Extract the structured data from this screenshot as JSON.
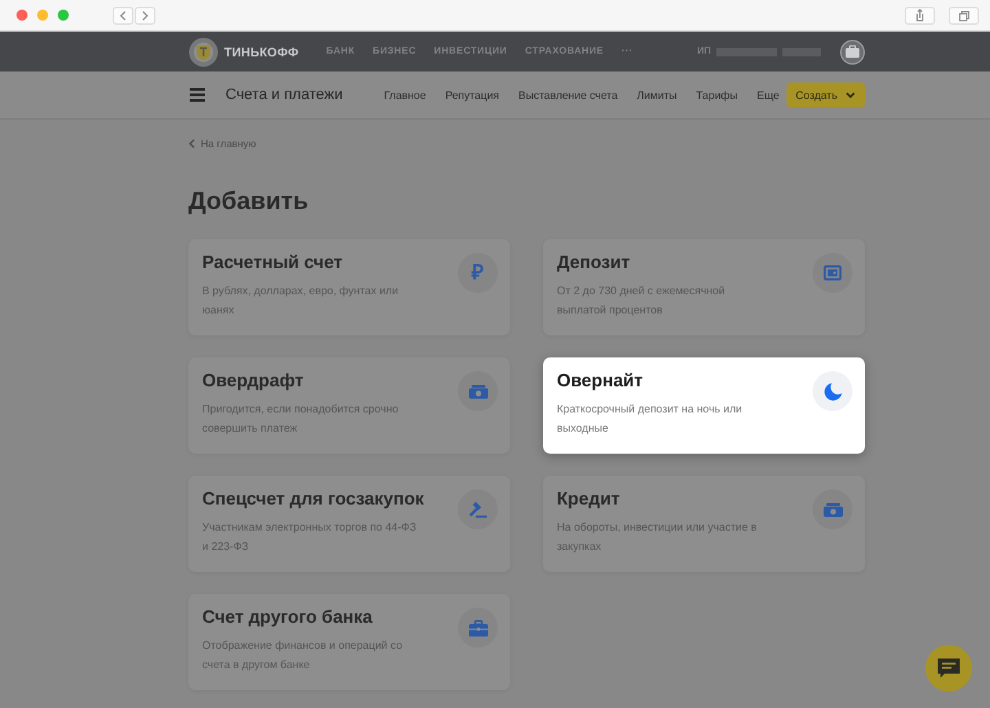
{
  "top_bar": {
    "logo": "ТИНЬКОФФ",
    "nav": [
      "БАНК",
      "БИЗНЕС",
      "ИНВЕСТИЦИИ",
      "СТРАХОВАНИЕ",
      "···"
    ],
    "account_prefix": "ИП"
  },
  "sub_nav": {
    "title": "Счета и платежи",
    "links": [
      "Главное",
      "Репутация",
      "Выставление счета",
      "Лимиты",
      "Тарифы",
      "Еще"
    ],
    "create_button": "Создать"
  },
  "back_link": "На главную",
  "heading": "Добавить",
  "cards": [
    {
      "title": "Расчетный счет",
      "description": "В рублях, долларах, евро, фунтах или юанях",
      "kind": "ruble",
      "icon_text": "₽",
      "highlighted": false
    },
    {
      "title": "Депозит",
      "description": "От 2 до 730 дней с ежемесячной выплатой процентов",
      "kind": "safe",
      "highlighted": false
    },
    {
      "title": "Овердрафт",
      "description": "Пригодится, если понадобится срочно совершить платеж",
      "kind": "cash",
      "highlighted": false
    },
    {
      "title": "Овернайт",
      "description": "Краткосрочный депозит на ночь или выходные",
      "kind": "moon",
      "highlighted": true
    },
    {
      "title": "Спецсчет для госзакупок",
      "description": "Участникам электронных торгов по 44-ФЗ и 223-ФЗ",
      "kind": "gavel",
      "highlighted": false
    },
    {
      "title": "Кредит",
      "description": "На обороты, инвестиции или участие в закупках",
      "kind": "cash",
      "highlighted": false
    },
    {
      "title": "Счет другого банка",
      "description": "Отображение финансов и операций со счета в другом банке",
      "kind": "briefcase",
      "highlighted": false
    }
  ]
}
